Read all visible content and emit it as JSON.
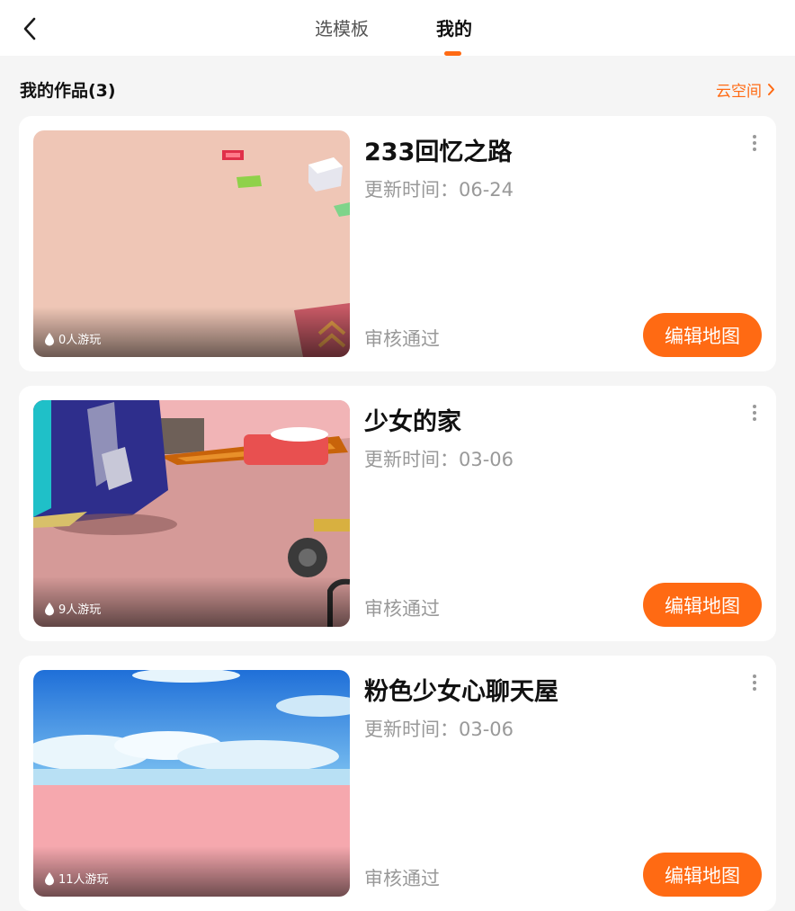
{
  "header": {
    "tabs": [
      {
        "label": "选模板",
        "active": false
      },
      {
        "label": "我的",
        "active": true
      }
    ],
    "accent_color": "#ff6a13"
  },
  "section": {
    "title": "我的作品(3)",
    "cloud_link": "云空间"
  },
  "works": [
    {
      "title": "233回忆之路",
      "updated": "更新时间：06-24",
      "status": "审核通过",
      "plays": "0人游玩",
      "edit_label": "编辑地图"
    },
    {
      "title": "少女的家",
      "updated": "更新时间：03-06",
      "status": "审核通过",
      "plays": "9人游玩",
      "edit_label": "编辑地图"
    },
    {
      "title": "粉色少女心聊天屋",
      "updated": "更新时间：03-06",
      "status": "审核通过",
      "plays": "11人游玩",
      "edit_label": "编辑地图"
    }
  ],
  "icons": {
    "back": "back-arrow-icon",
    "chevron": "chevron-right-icon",
    "more": "more-vertical-icon",
    "plays": "droplet-icon"
  }
}
